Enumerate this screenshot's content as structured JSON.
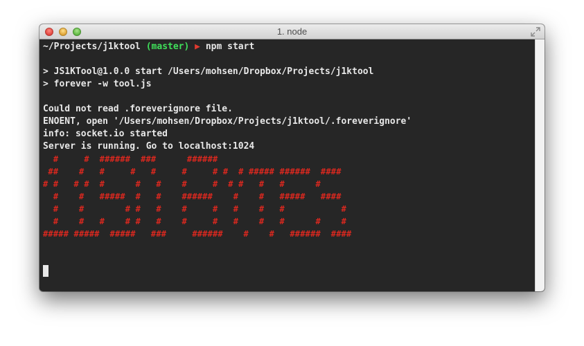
{
  "window": {
    "title": "1. node"
  },
  "prompt": {
    "path": "~/Projects/j1ktool",
    "branch": "(master)",
    "arrow": "▶",
    "command": "npm start"
  },
  "output": {
    "npm_line_1": "> JS1KTool@1.0.0 start /Users/mohsen/Dropbox/Projects/j1ktool",
    "npm_line_2": "> forever -w tool.js",
    "err_line_1": "Could not read .foreverignore file.",
    "err_line_2": "ENOENT, open '/Users/mohsen/Dropbox/Projects/j1ktool/.foreverignore'",
    "info_line": "info: socket.io started",
    "server_line": "Server is running. Go to localhost:1024"
  },
  "banner": [
    "  #     #  ######  ###      ######",
    " ##    #   #     #   #     #     # #  # ##### ######  ####",
    "# #   # #  #      #   #    #     #  # #   #   #      #",
    "  #    #   #####  #   #    ######    #    #   #####   ####",
    "  #    #        # #   #    #     #   #    #   #           #",
    "  #    #   #    # #   #    #     #   #    #   #      #    #",
    "##### #####  #####   ###     ######    #    #   ######  ####"
  ],
  "colors": {
    "background": "#262626",
    "text": "#e8e8e8",
    "branch": "#3fe05a",
    "banner": "#d8281f"
  },
  "icons": {
    "prompt_arrow": "triangle-right-icon",
    "fullscreen": "fullscreen-arrows-icon"
  }
}
